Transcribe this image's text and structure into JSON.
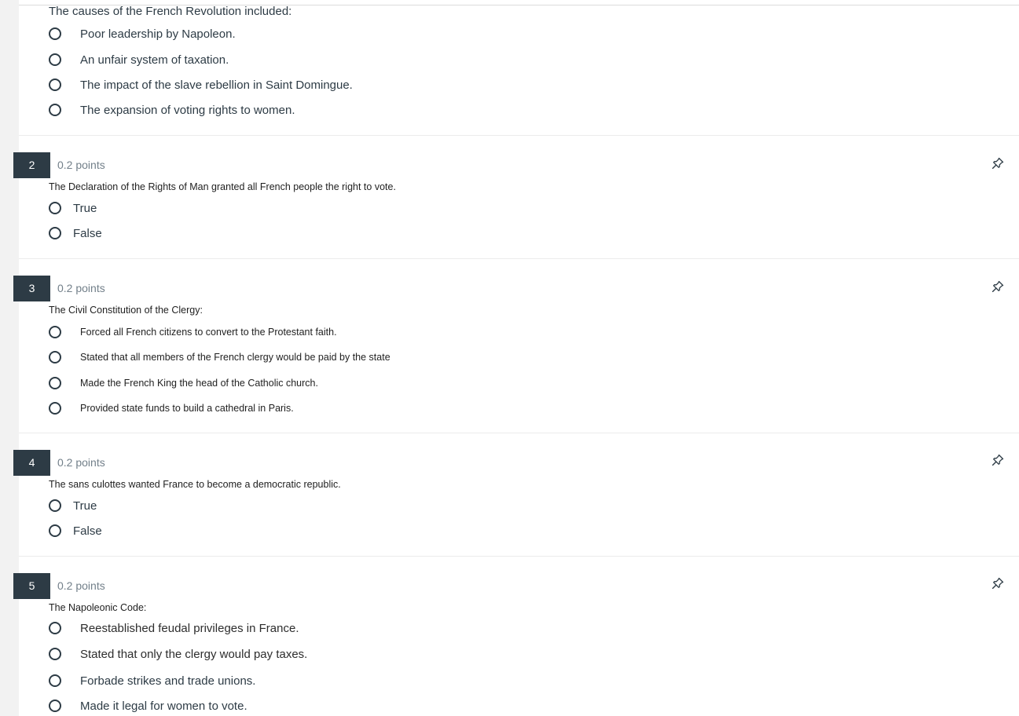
{
  "q1": {
    "text": "The causes of the French Revolution included:",
    "answers": [
      "Poor leadership by Napoleon.",
      "An unfair system of taxation.",
      "The impact of the slave rebellion in Saint Domingue.",
      "The expansion of voting rights to women."
    ]
  },
  "q2": {
    "number": "2",
    "points": "0.2 points",
    "text": "The Declaration of the Rights of Man granted all French people the right to vote.",
    "answers": [
      "True",
      "False"
    ]
  },
  "q3": {
    "number": "3",
    "points": "0.2 points",
    "text": "The Civil Constitution of the Clergy:",
    "answers": [
      "Forced all French citizens to convert to the Protestant faith.",
      "Stated that all members of the French clergy would be paid by the state",
      "Made the French King the head of the Catholic church.",
      "Provided state funds to build a cathedral in Paris."
    ]
  },
  "q4": {
    "number": "4",
    "points": "0.2 points",
    "text": "The sans culottes wanted France to become a democratic republic.",
    "answers": [
      "True",
      "False"
    ]
  },
  "q5": {
    "number": "5",
    "points": "0.2 points",
    "text": "The Napoleonic Code:",
    "answers": [
      "Reestablished feudal privileges in France.",
      "Stated that only the clergy would pay taxes.",
      "Forbade strikes and trade unions.",
      "Made it legal for women to vote."
    ]
  },
  "icons": {
    "pin": "pin-icon",
    "radio": "radio-unselected-icon"
  },
  "colors": {
    "number_badge": "#2d3b45",
    "text": "#2d3b45",
    "points": "#73808a"
  }
}
